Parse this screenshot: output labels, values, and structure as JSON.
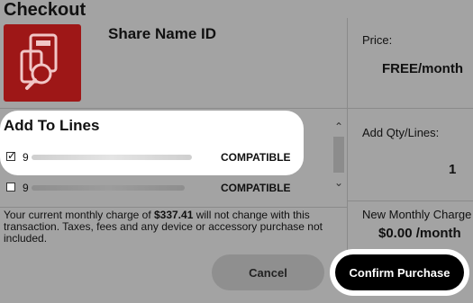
{
  "page": {
    "title": "Checkout"
  },
  "product": {
    "name": "Share Name ID",
    "icon": "contact-search-icon",
    "icon_color": "#9e1717"
  },
  "price": {
    "label": "Price:",
    "value": "FREE/month"
  },
  "add_to_lines": {
    "title": "Add To Lines",
    "lines": [
      {
        "number_prefix": "9",
        "checked": true,
        "status": "COMPATIBLE"
      },
      {
        "number_prefix": "9",
        "checked": false,
        "status": "COMPATIBLE"
      }
    ]
  },
  "qty": {
    "label": "Add Qty/Lines:",
    "value": "1"
  },
  "monthly_charge": {
    "label": "New Monthly Charge",
    "value": "$0.00 /month"
  },
  "notice": {
    "prefix": "Your current monthly charge of ",
    "amount": "$337.41",
    "suffix": " will not change with this transaction. Taxes, fees and any device or accessory purchase not included."
  },
  "buttons": {
    "cancel": "Cancel",
    "confirm": "Confirm Purchase"
  }
}
